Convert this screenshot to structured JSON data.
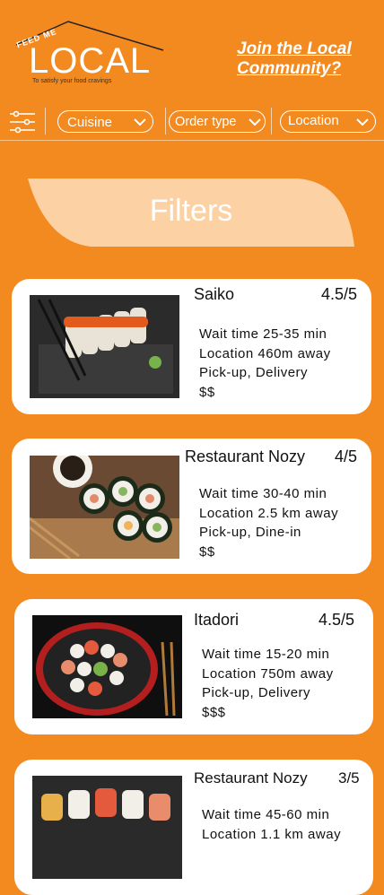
{
  "logo": {
    "top": "FEED ME",
    "main": "LOCAL",
    "tagline": "To satisfy your food cravings"
  },
  "header": {
    "join_line1": "Join the Local",
    "join_line2": "Community?"
  },
  "filterbar": {
    "cuisine": "Cuisine",
    "order_type": "Order type",
    "location": "Location"
  },
  "filters_title": "Filters",
  "restaurants": [
    {
      "name": "Saiko",
      "rating": "4.5/5",
      "wait": "Wait time 25-35 min",
      "location": "Location 460m away",
      "options": "Pick-up, Delivery",
      "price": "$$"
    },
    {
      "name": "Restaurant Nozy",
      "rating": "4/5",
      "wait": "Wait time 30-40 min",
      "location": "Location 2.5 km away",
      "options": "Pick-up, Dine-in",
      "price": "$$"
    },
    {
      "name": "Itadori",
      "rating": "4.5/5",
      "wait": "Wait time 15-20 min",
      "location": "Location 750m away",
      "options": "Pick-up, Delivery",
      "price": "$$$"
    },
    {
      "name": "Restaurant Nozy",
      "rating": "3/5",
      "wait": "Wait time 45-60 min",
      "location": "Location 1.1 km away",
      "options": "",
      "price": ""
    }
  ],
  "colors": {
    "background": "#f28a1f",
    "banner": "#fcd2a4",
    "card": "#ffffff"
  }
}
